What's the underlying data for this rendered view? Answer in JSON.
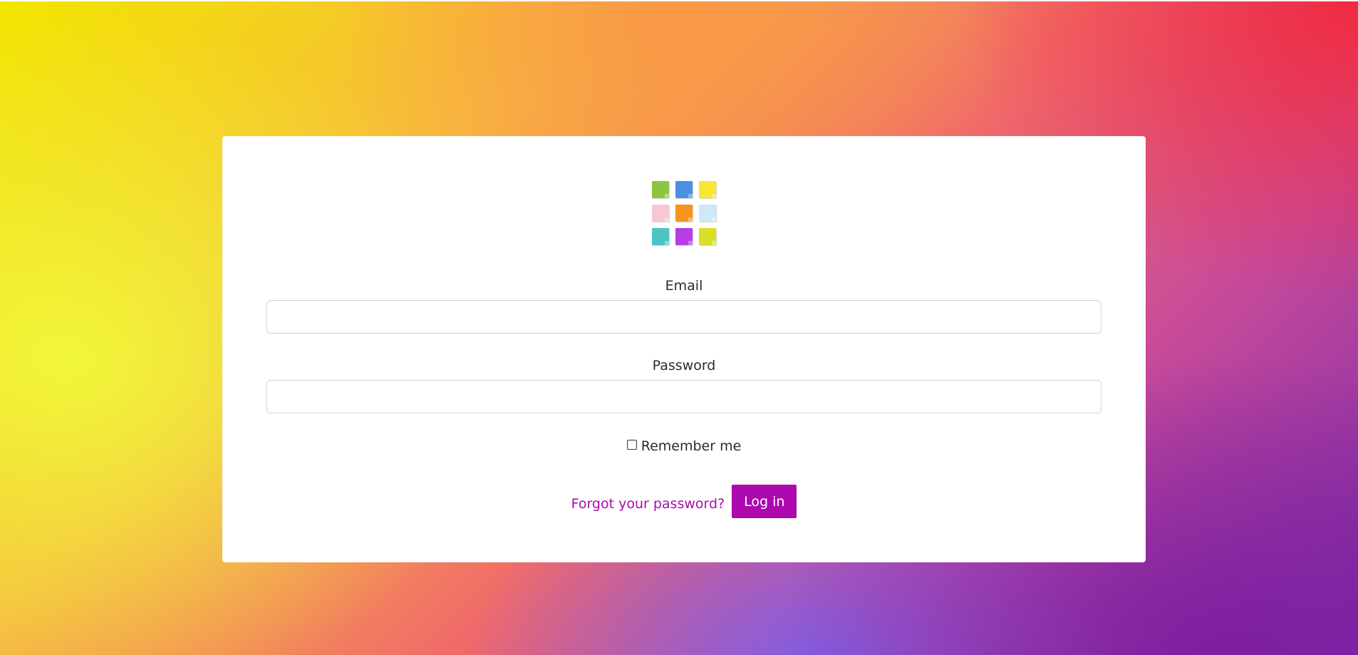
{
  "logo": {
    "notes": [
      {
        "icon": "sticky-note-icon",
        "color": "#8cc63f"
      },
      {
        "icon": "sticky-note-icon",
        "color": "#4a90e2"
      },
      {
        "icon": "sticky-note-icon",
        "color": "#f7e733"
      },
      {
        "icon": "sticky-note-icon",
        "color": "#f8c7d4"
      },
      {
        "icon": "sticky-note-icon",
        "color": "#f7941d"
      },
      {
        "icon": "sticky-note-icon",
        "color": "#cfe8f9"
      },
      {
        "icon": "sticky-note-icon",
        "color": "#4cc4c4"
      },
      {
        "icon": "sticky-note-icon",
        "color": "#b63de6"
      },
      {
        "icon": "sticky-note-icon",
        "color": "#d9df24"
      }
    ]
  },
  "form": {
    "email_label": "Email",
    "email_value": "",
    "password_label": "Password",
    "password_value": "",
    "remember_label": "Remember me",
    "remember_checked": false,
    "forgot_link": "Forgot your password?",
    "login_button": "Log in"
  },
  "colors": {
    "accent": "#ab09ad",
    "link": "#a40ea9",
    "card": "#ffffff"
  }
}
